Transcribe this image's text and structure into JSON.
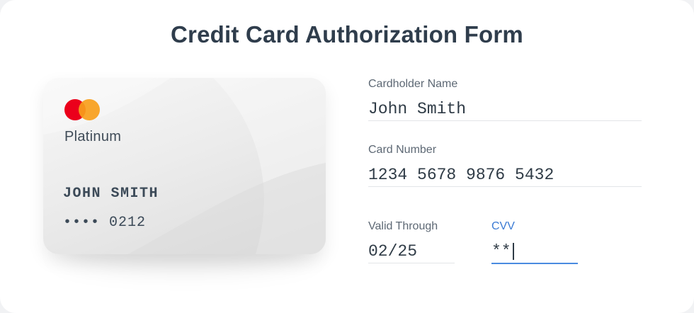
{
  "title": "Credit Card Authorization Form",
  "card": {
    "brand_icon": "mastercard-logo",
    "tier": "Platinum",
    "holder": "JOHN SMITH",
    "number_masked": "•••• 0212"
  },
  "form": {
    "cardholder_name": {
      "label": "Cardholder Name",
      "value": "John Smith"
    },
    "card_number": {
      "label": "Card Number",
      "value": "1234 5678 9876 5432"
    },
    "valid_through": {
      "label": "Valid Through",
      "value": "02/25"
    },
    "cvv": {
      "label": "CVV",
      "value": "**"
    }
  },
  "colors": {
    "accent": "#3b7bd4",
    "title": "#2f3d4c",
    "mastercard_red": "#eb001b",
    "mastercard_orange": "#f79e1b"
  }
}
